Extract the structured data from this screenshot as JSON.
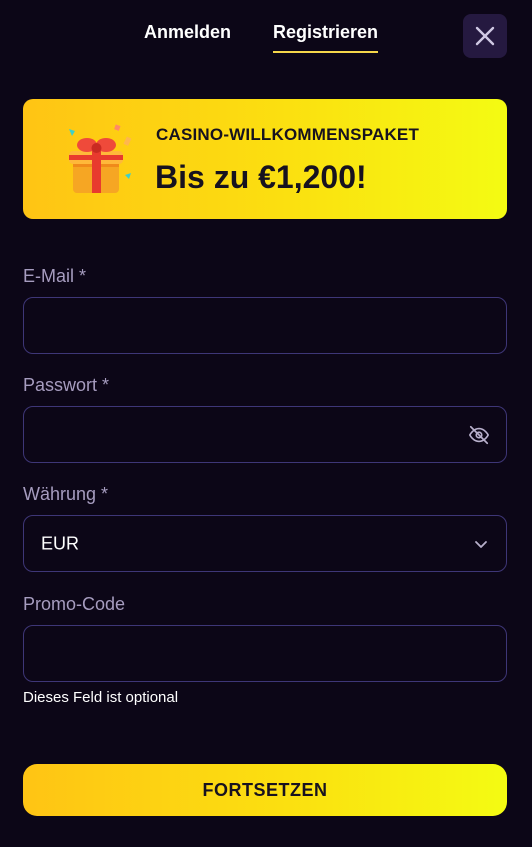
{
  "tabs": {
    "login_label": "Anmelden",
    "register_label": "Registrieren",
    "active": "register"
  },
  "close_icon": "close-icon",
  "banner": {
    "subtitle": "CASINO-WILLKOMMENSPAKET",
    "title": "Bis zu €1,200!",
    "icon": "gift-icon"
  },
  "form": {
    "email": {
      "label": "E-Mail *",
      "value": "",
      "placeholder": ""
    },
    "password": {
      "label": "Passwort *",
      "value": "",
      "placeholder": "",
      "toggle_icon": "eye-off-icon"
    },
    "currency": {
      "label": "Währung *",
      "value": "EUR",
      "chevron_icon": "chevron-down-icon"
    },
    "promo": {
      "label": "Promo-Code",
      "value": "",
      "placeholder": "",
      "hint": "Dieses Feld ist optional"
    }
  },
  "submit_label": "FORTSETZEN",
  "colors": {
    "background": "#0c0617",
    "accent_start": "#ffc414",
    "accent_end": "#f4fb12",
    "field_border": "#3e3677",
    "label": "#a69cbf",
    "tab_underline": "#f5d64a"
  }
}
